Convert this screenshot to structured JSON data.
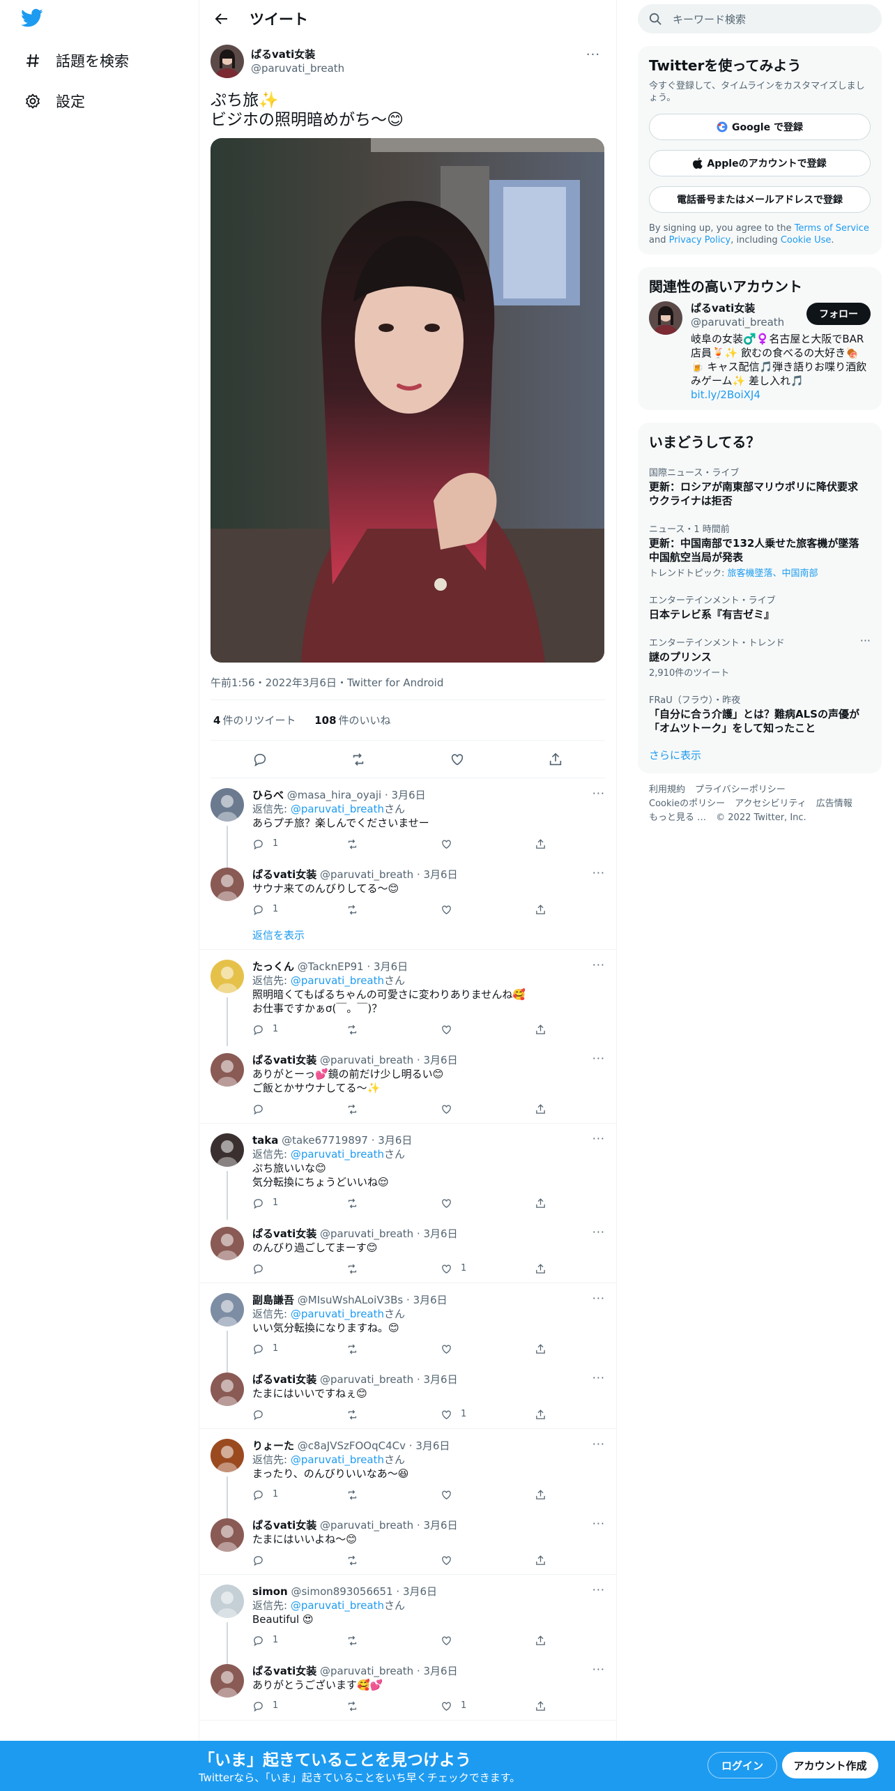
{
  "nav": {
    "explore_label": "話題を検索",
    "settings_label": "設定"
  },
  "header": {
    "title": "ツイート"
  },
  "main_tweet": {
    "name": "ぱるvati女装",
    "handle": "@paruvati_breath",
    "text": "ぷち旅✨\nビジホの照明暗めがち〜😊",
    "meta": "午前1:56・2022年3月6日・Twitter for Android",
    "retweets_count": "4",
    "retweets_label": "件のリツイート",
    "likes_count": "108",
    "likes_label": "件のいいね"
  },
  "replies": [
    {
      "name": "ひらべ",
      "handle": "@masa_hira_oyaji",
      "date": "3月6日",
      "reply_to_prefix": "返信先: ",
      "reply_to": "@paruvati_breath",
      "reply_to_suffix": "さん",
      "text": "あらプチ旅？楽しんでくださいませー",
      "reply_count": "1",
      "like_count": "",
      "avatar": "#6b7a8f"
    },
    {
      "name": "ぱるvati女装",
      "handle": "@paruvati_breath",
      "date": "3月6日",
      "reply_to_prefix": "",
      "reply_to": "",
      "reply_to_suffix": "",
      "text": "サウナ来てのんびりしてる〜😊",
      "reply_count": "1",
      "like_count": "",
      "avatar": "#8a5a55"
    },
    {
      "name": "たっくん",
      "handle": "@TacknEP91",
      "date": "3月6日",
      "reply_to_prefix": "返信先: ",
      "reply_to": "@paruvati_breath",
      "reply_to_suffix": "さん",
      "text": "照明暗くてもぱるちゃんの可愛さに変わりありませんね🥰\nお仕事ですかぁσ(￣。￣)？",
      "reply_count": "1",
      "like_count": "",
      "avatar": "#e6c14a"
    },
    {
      "name": "ぱるvati女装",
      "handle": "@paruvati_breath",
      "date": "3月6日",
      "reply_to_prefix": "",
      "reply_to": "",
      "reply_to_suffix": "",
      "text": "ありがとーっ💕鏡の前だけ少し明るい😊\nご飯とかサウナしてる〜✨",
      "reply_count": "",
      "like_count": "",
      "avatar": "#8a5a55"
    },
    {
      "name": "taka",
      "handle": "@take67719897",
      "date": "3月6日",
      "reply_to_prefix": "返信先: ",
      "reply_to": "@paruvati_breath",
      "reply_to_suffix": "さん",
      "text": "ぷち旅いいな😊\n気分転換にちょうどいいね😌",
      "reply_count": "1",
      "like_count": "",
      "avatar": "#3a3030"
    },
    {
      "name": "ぱるvati女装",
      "handle": "@paruvati_breath",
      "date": "3月6日",
      "reply_to_prefix": "",
      "reply_to": "",
      "reply_to_suffix": "",
      "text": "のんびり過ごしてまーす😊",
      "reply_count": "",
      "like_count": "1",
      "avatar": "#8a5a55"
    },
    {
      "name": "副島謙吾",
      "handle": "@MIsuWshALoiV3Bs",
      "date": "3月6日",
      "reply_to_prefix": "返信先: ",
      "reply_to": "@paruvati_breath",
      "reply_to_suffix": "さん",
      "text": "いい気分転換になりますね。😊",
      "reply_count": "1",
      "like_count": "",
      "avatar": "#7d8da3"
    },
    {
      "name": "ぱるvati女装",
      "handle": "@paruvati_breath",
      "date": "3月6日",
      "reply_to_prefix": "",
      "reply_to": "",
      "reply_to_suffix": "",
      "text": "たまにはいいですねぇ😊",
      "reply_count": "",
      "like_count": "1",
      "avatar": "#8a5a55"
    },
    {
      "name": "りょーた",
      "handle": "@c8aJVSzFOOqC4Cv",
      "date": "3月6日",
      "reply_to_prefix": "返信先: ",
      "reply_to": "@paruvati_breath",
      "reply_to_suffix": "さん",
      "text": "まったり、のんびりいいなあ〜😆",
      "reply_count": "1",
      "like_count": "",
      "avatar": "#9b4a20"
    },
    {
      "name": "ぱるvati女装",
      "handle": "@paruvati_breath",
      "date": "3月6日",
      "reply_to_prefix": "",
      "reply_to": "",
      "reply_to_suffix": "",
      "text": "たまにはいいよね〜😊",
      "reply_count": "",
      "like_count": "",
      "avatar": "#8a5a55"
    },
    {
      "name": "simon",
      "handle": "@simon893056651",
      "date": "3月6日",
      "reply_to_prefix": "返信先: ",
      "reply_to": "@paruvati_breath",
      "reply_to_suffix": "さん",
      "text": "Beautiful 😍",
      "reply_count": "1",
      "like_count": "",
      "avatar": "#c4cfd6"
    },
    {
      "name": "ぱるvati女装",
      "handle": "@paruvati_breath",
      "date": "3月6日",
      "reply_to_prefix": "",
      "reply_to": "",
      "reply_to_suffix": "",
      "text": "ありがとうございます🥰💕",
      "reply_count": "1",
      "like_count": "1",
      "avatar": "#8a5a55"
    }
  ],
  "show_replies_label": "返信を表示",
  "search": {
    "placeholder": "キーワード検索"
  },
  "signup_card": {
    "title": "Twitterを使ってみよう",
    "subtitle": "今すぐ登録して、タイムラインをカスタマイズしましょう。",
    "google": "Google で登録",
    "apple": "Appleのアカウントで登録",
    "phone": "電話番号またはメールアドレスで登録",
    "legal_1": "By signing up, you agree to the ",
    "tos": "Terms of Service",
    "legal_2": " and ",
    "privacy": "Privacy Policy",
    "legal_3": ", including ",
    "cookie": "Cookie Use",
    "legal_4": "."
  },
  "related": {
    "title": "関連性の高いアカウント",
    "name": "ぱるvati女装",
    "handle": "@paruvati_breath",
    "follow": "フォロー",
    "bio": "岐阜の女装♂️♀️名古屋と大阪でBAR店員🍹✨ 飲むの食べるの大好き🍖🍺 キャス配信🎵弾き語りお喋り酒飲みゲーム✨ 差し入れ🎵",
    "link": "bit.ly/2BoiXJ4"
  },
  "trends": {
    "title": "いまどうしてる？",
    "items": [
      {
        "cat": "国際ニュース・ライブ",
        "title": "更新：ロシアが南東部マリウポリに降伏要求 ウクライナは拒否",
        "meta": "",
        "topics_prefix": "",
        "topics": ""
      },
      {
        "cat": "ニュース・1 時間前",
        "title": "更新：中国南部で132人乗せた旅客機が墜落 中国航空当局が発表",
        "meta": "",
        "topics_prefix": "トレンドトピック: ",
        "topics": "旅客機墜落、中国南部"
      },
      {
        "cat": "エンターテインメント・ライブ",
        "title": "日本テレビ系『有吉ゼミ』",
        "meta": "",
        "topics_prefix": "",
        "topics": ""
      },
      {
        "cat": "エンターテインメント・トレンド",
        "title": "謎のプリンス",
        "meta": "2,910件のツイート",
        "topics_prefix": "",
        "topics": ""
      },
      {
        "cat": "FRaU（フラウ）・昨夜",
        "title": "「自分に合う介護」とは？難病ALSの声優が「オムツトーク」をして知ったこと",
        "meta": "",
        "topics_prefix": "",
        "topics": ""
      }
    ],
    "show_more": "さらに表示"
  },
  "footer": {
    "terms": "利用規約",
    "privacy": "プライバシーポリシー",
    "cookie": "Cookieのポリシー",
    "access": "アクセシビリティ",
    "ads": "広告情報",
    "more": "もっと見る …",
    "copy": "© 2022 Twitter, Inc."
  },
  "bottom_bar": {
    "title": "「いま」起きていることを見つけよう",
    "subtitle": "Twitterなら、「いま」起きていることをいち早くチェックできます。",
    "login": "ログイン",
    "signup": "アカウント作成"
  },
  "colors": {
    "accent": "#1d9bf0",
    "text": "#0f1419",
    "muted": "#536471",
    "card": "#f7f9f9"
  }
}
